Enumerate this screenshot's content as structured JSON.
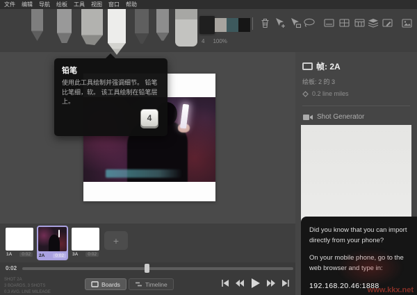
{
  "menu": {
    "items": [
      "文件",
      "编辑",
      "导航",
      "绘板",
      "工具",
      "视图",
      "窗口",
      "帮助"
    ]
  },
  "toolbar": {
    "tools": [
      "light-pencil",
      "hard-pencil",
      "marker",
      "pencil",
      "pen",
      "brush",
      "eraser"
    ],
    "selected_tool": "pencil",
    "brush_size": "4",
    "brush_opacity": "100%",
    "swatches": [
      "#1f1f1f",
      "#a7a49f",
      "#3d595d",
      "#161616"
    ],
    "action_icons": [
      "trash-icon",
      "add-board-cursor-icon",
      "duplicate-board-cursor-icon",
      "lasso-icon",
      "captions-board-icon",
      "grid-board-icon",
      "details-board-icon",
      "layers-icon",
      "annotate-board-icon",
      "export-image-icon"
    ]
  },
  "tooltip": {
    "title": "铅笔",
    "body": "使用此工具绘制并强调细节。 铅笔比笔细，软。 该工具绘制在铅笔层上。",
    "shortcut_key": "4"
  },
  "sidebar": {
    "frame_label": "帧: 2A",
    "board_position_label": "绘板: 2 的 3",
    "line_mileage_label": "0.2 line miles",
    "shot_generator_label": "Shot Generator"
  },
  "phone_import": {
    "line1": "Did you know that you can import directly from your phone?",
    "line2": "On your mobile phone, go to the web browser and type in:",
    "address": "192.168.20.46:1888"
  },
  "board_strip": {
    "boards": [
      {
        "id": "1A",
        "duration": "0:02",
        "selected": false
      },
      {
        "id": "2A",
        "duration": "0:02",
        "selected": true
      },
      {
        "id": "3A",
        "duration": "0:02",
        "selected": false
      }
    ],
    "add_button_label": "+"
  },
  "timeline": {
    "current_time": "0:02"
  },
  "status": {
    "lines": [
      "SHOT 2A",
      "3 BOARDS, 3 SHOTS",
      "0.3 AVG. LINE MILEAGE"
    ]
  },
  "view_toggle": {
    "boards_label": "Boards",
    "timeline_label": "Timeline",
    "active": "Boards"
  },
  "playback": {
    "buttons": [
      "first-frame",
      "previous-frame",
      "play",
      "next-frame",
      "last-frame"
    ]
  },
  "watermark": {
    "text": "www.kkx.net"
  },
  "colors": {
    "accent_purple": "#a9a1e0",
    "tooltip_bg": "#151515",
    "canvas_white": "#fdfdfd",
    "sidebar_bg": "#454545",
    "toolbar_bg": "#3f3f3f",
    "menubar_bg": "#2e2e2e"
  }
}
